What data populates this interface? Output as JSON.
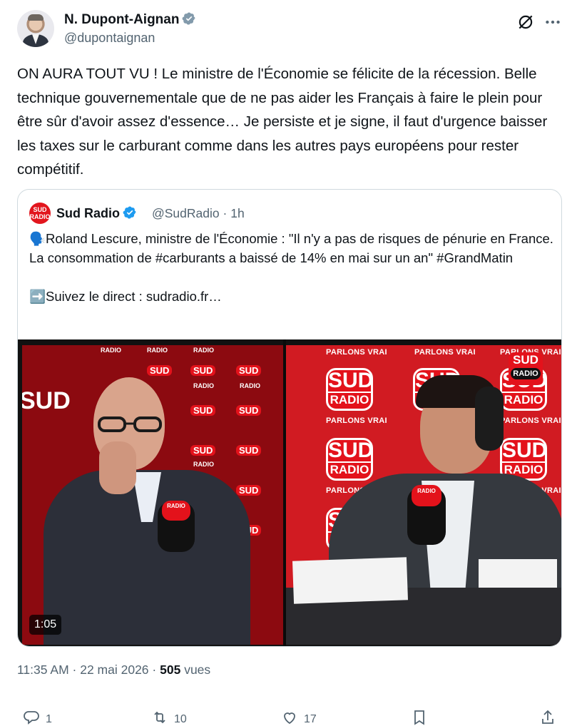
{
  "author": {
    "name": "N. Dupont-Aignan",
    "handle": "@dupontaignan"
  },
  "tweet": {
    "text": "ON AURA TOUT VU ! Le ministre de l'Économie se félicite de la récession. Belle technique gouvernementale que de ne pas aider les Français à faire le plein pour être sûr d'avoir assez d'essence… Je persiste et je signe, il faut d'urgence baisser les taxes sur le carburant comme dans les autres pays européens pour rester compétitif."
  },
  "quote": {
    "logo_text": "SUD RADIO",
    "name": "Sud Radio",
    "handle": "@SudRadio",
    "separator": "·",
    "time": "1h",
    "line1": "🗣️Roland Lescure, ministre de l'Économie : \"Il n'y a pas de risques de pénurie en France. La consommation de #carburants a baissé de 14% en mai sur un an\" #GrandMatin",
    "line2": "➡️Suivez le direct : sudradio.fr…",
    "video": {
      "duration": "1:05",
      "logo_sud": "SUD",
      "logo_radio": "RADIO",
      "slogan": "PARLONS VRAI"
    }
  },
  "meta": {
    "time": "11:35 AM",
    "separator": "·",
    "date": "22 mai 2026",
    "views_count": "505",
    "views_label": "vues"
  },
  "actions": {
    "replies": "1",
    "reposts": "10",
    "likes": "17"
  },
  "icons": [
    "verified-badge-icon",
    "grok-icon",
    "more-icon",
    "reply-icon",
    "repost-icon",
    "like-icon",
    "bookmark-icon",
    "share-icon"
  ],
  "colors": {
    "text": "#0f1419",
    "secondary": "#536471",
    "verified": "#1d9bf0",
    "brand_red": "#e3121b",
    "border": "#cfd9de"
  }
}
